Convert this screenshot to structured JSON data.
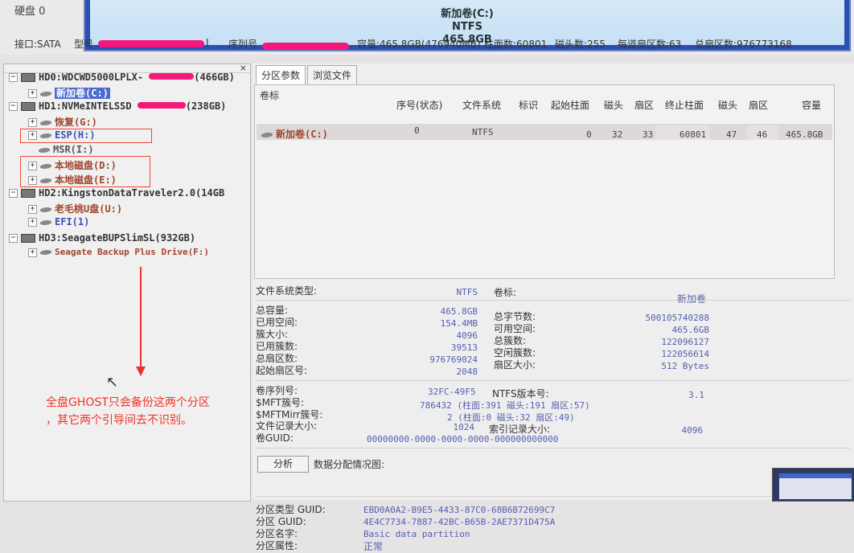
{
  "top": {
    "disk_label": "硬盘 0",
    "partition_name": "新加卷(C:)",
    "partition_fs": "NTFS",
    "partition_size": "465.8GB"
  },
  "info": {
    "interface": "接口:SATA",
    "model_label": "型号",
    "model_tail": "I",
    "serial_label": "序列号",
    "capacity": "容量:465.8GB(476940MB)",
    "cylinders": "柱面数:60801",
    "heads": "磁头数:255",
    "sectors_per_track": "每道扇区数:63",
    "total_sectors": "总扇区数:976773168"
  },
  "tree": {
    "close": "×",
    "items": [
      {
        "label": "HD0:WDCWD5000LPLX-",
        "suffix": "(466GB)",
        "type": "disk"
      },
      {
        "label": "新加卷(C:)",
        "type": "part-selected"
      },
      {
        "label": "HD1:NVMeINTELSSD",
        "suffix": "(238GB)",
        "type": "disk"
      },
      {
        "label": "恢复(G:)",
        "type": "part-brown"
      },
      {
        "label": "ESP(H:)",
        "type": "part-blue"
      },
      {
        "label": "MSR(I:)",
        "type": "part-gray"
      },
      {
        "label": "本地磁盘(D:)",
        "type": "part-brown"
      },
      {
        "label": "本地磁盘(E:)",
        "type": "part-brown"
      },
      {
        "label": "HD2:KingstonDataTraveler2.0(14GB",
        "type": "disk"
      },
      {
        "label": "老毛桃U盘(U:)",
        "type": "part-brown"
      },
      {
        "label": "EFI(1)",
        "type": "part-blue"
      },
      {
        "label": "HD3:SeagateBUPSlimSL(932GB)",
        "type": "disk"
      },
      {
        "label": "Seagate Backup Plus Drive(F:)",
        "type": "part-brown"
      }
    ],
    "annotation_line1": "全盘GHOST只会备份这两个分区",
    "annotation_line2": "，其它两个引导间去不识别。"
  },
  "tabs": [
    "分区参数",
    "浏览文件"
  ],
  "table": {
    "headers": [
      "卷标",
      "序号(状态)",
      "文件系统",
      "标识",
      "起始柱面",
      "磁头",
      "扇区",
      "终止柱面",
      "磁头",
      "扇区",
      "容量"
    ],
    "row": {
      "volume": "新加卷(C:)",
      "index": "0",
      "fs": "NTFS",
      "id": "",
      "start_cyl": "0",
      "start_head": "32",
      "start_sector": "33",
      "end_cyl": "60801",
      "end_head": "47",
      "end_sector": "46",
      "capacity": "465.8GB"
    }
  },
  "details": {
    "fs_type_label": "文件系统类型:",
    "fs_type_value": "NTFS",
    "vol_label_label": "卷标:",
    "vol_label_value": "新加卷",
    "total_cap_label": "总容量:",
    "total_cap_value": "465.8GB",
    "total_bytes_label": "总字节数:",
    "total_bytes_value": "500105740288",
    "used_label": "已用空间:",
    "used_value": "154.4MB",
    "free_label": "可用空间:",
    "free_value": "465.6GB",
    "cluster_size_label": "簇大小:",
    "cluster_size_value": "4096",
    "total_clusters_label": "总簇数:",
    "total_clusters_value": "122096127",
    "used_clusters_label": "已用簇数:",
    "used_clusters_value": "39513",
    "free_clusters_label": "空闲簇数:",
    "free_clusters_value": "122056614",
    "total_sectors_label": "总扇区数:",
    "total_sectors_value": "976769024",
    "sector_size_label": "扇区大小:",
    "sector_size_value": "512 Bytes",
    "start_sector_label": "起始扇区号:",
    "start_sector_value": "2048",
    "serial_label": "卷序列号:",
    "serial_value": "32FC-49F5",
    "ntfs_ver_label": "NTFS版本号:",
    "ntfs_ver_value": "3.1",
    "mft_label": "$MFT簇号:",
    "mft_value": "786432 (柱面:391 磁头:191 扇区:57)",
    "mftmirr_label": "$MFTMirr簇号:",
    "mftmirr_value": "2 (柱面:0 磁头:32 扇区:49)",
    "record_size_label": "文件记录大小:",
    "record_size_value": "1024",
    "index_size_label": "索引记录大小:",
    "index_size_value": "4096",
    "guid_label": "卷GUID:",
    "guid_value": "00000000-0000-0000-0000-000000000000",
    "analyze_btn": "分析",
    "alloc_label": "数据分配情况图:",
    "ptype_guid_label": "分区类型 GUID:",
    "ptype_guid_value": "EBD0A0A2-B9E5-4433-87C0-68B6B72699C7",
    "part_guid_label": "分区 GUID:",
    "part_guid_value": "4E4C7734-7887-42BC-B65B-2AE7371D475A",
    "part_name_label": "分区名字:",
    "part_name_value": "Basic data partition",
    "part_attr_label": "分区属性:",
    "part_attr_value": "正常"
  },
  "colors": {
    "accent_blue": "#2b4fb0",
    "annotation_red": "#f03427",
    "volume_brown": "#a0442c"
  }
}
